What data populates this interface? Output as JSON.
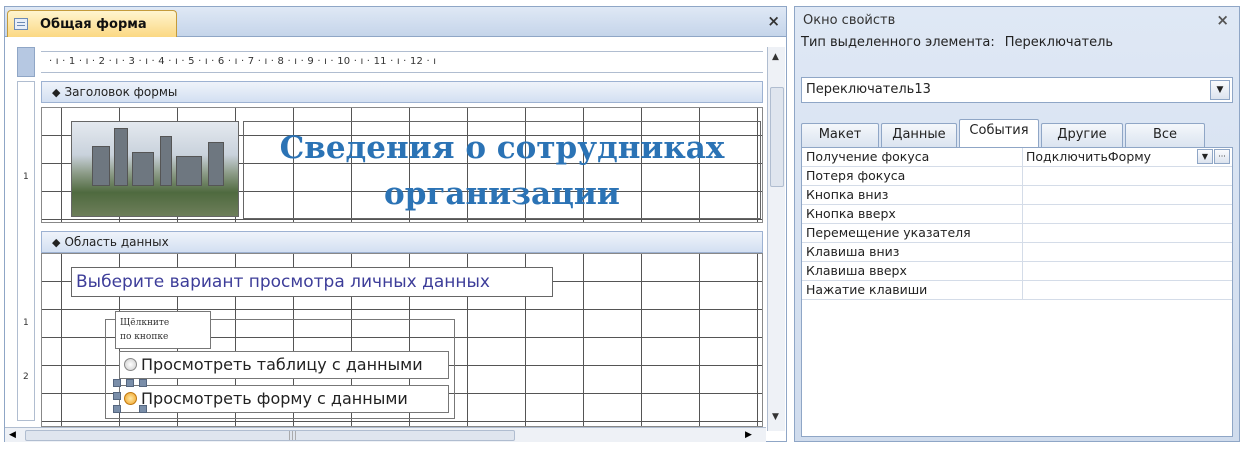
{
  "form_window": {
    "tab_title": "Общая форма",
    "tab_icon": "form-icon",
    "close_symbol": "×",
    "ruler_text": "· ı · 1 · ı · 2 · ı · 3 · ı · 4 · ı · 5 · ı · 6 · ı · 7 · ı · 8 · ı · 9 · ı · 10 · ı · 11 · ı · 12 · ı",
    "vruler_marks": [
      "1",
      "1",
      "2"
    ],
    "section_header": "Заголовок формы",
    "section_data": "Область данных",
    "section_marker": "◆",
    "title_line1": "Сведения о сотрудниках",
    "title_line2": "организации",
    "prompt": "Выберите вариант просмотра личных данных",
    "group_label_line1": "Щёлкните",
    "group_label_line2": "по кнопке",
    "option1": "Просмотреть таблицу с данными",
    "option2": "Просмотреть форму с данными",
    "scroll_up": "▲",
    "scroll_down": "▼",
    "scroll_left": "◀",
    "scroll_right": "▶",
    "grip": "|||"
  },
  "property_sheet": {
    "title": "Окно свойств",
    "close_symbol": "×",
    "selected_type_label": "Тип выделенного элемента:",
    "selected_type_value": "Переключатель",
    "selected_object": "Переключатель13",
    "combo_arrow": "▼",
    "tabs": [
      "Макет",
      "Данные",
      "События",
      "Другие",
      "Все"
    ],
    "active_tab": "События",
    "rows": [
      {
        "name": "Получение фокуса",
        "value": "ПодключитьФорму"
      },
      {
        "name": "Потеря фокуса",
        "value": ""
      },
      {
        "name": "Кнопка вниз",
        "value": ""
      },
      {
        "name": "Кнопка вверх",
        "value": ""
      },
      {
        "name": "Перемещение указателя",
        "value": ""
      },
      {
        "name": "Клавиша вниз",
        "value": ""
      },
      {
        "name": "Клавиша вверх",
        "value": ""
      },
      {
        "name": "Нажатие клавиши",
        "value": ""
      }
    ],
    "value_dropdown_btn": "▼",
    "value_builder_btn": "···"
  }
}
